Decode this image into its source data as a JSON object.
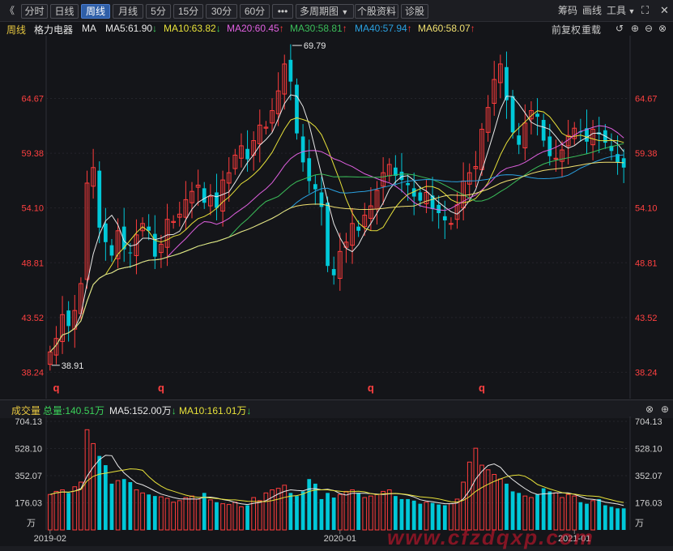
{
  "toolbar": {
    "back": "《",
    "tabs": [
      {
        "label": "分时",
        "active": false
      },
      {
        "label": "日线",
        "active": false
      },
      {
        "label": "周线",
        "active": true
      },
      {
        "label": "月线",
        "active": false
      },
      {
        "label": "5分",
        "active": false
      },
      {
        "label": "15分",
        "active": false
      },
      {
        "label": "30分",
        "active": false
      },
      {
        "label": "60分",
        "active": false
      }
    ],
    "more": "•••",
    "multi_period": "多周期图",
    "stock_info": "个股资料",
    "diagnose": "诊股",
    "right": {
      "chips": "筹码",
      "draw": "画线",
      "tools": "工具"
    }
  },
  "header": {
    "period": "周线",
    "stock_name": "格力电器",
    "ma_label": "MA",
    "ma": [
      {
        "label": "MA5:61.90",
        "dir": "↓",
        "color": "#e8e8e8"
      },
      {
        "label": "MA10:63.82",
        "dir": "↓",
        "color": "#e8e23a"
      },
      {
        "label": "MA20:60.45",
        "dir": "↑",
        "color": "#e060e0"
      },
      {
        "label": "MA30:58.81",
        "dir": "↑",
        "color": "#3bbf5a"
      },
      {
        "label": "MA40:57.94",
        "dir": "↑",
        "color": "#2aa0e0"
      },
      {
        "label": "MA60:58.07",
        "dir": "↑",
        "color": "#f0e070"
      }
    ],
    "adjust": "前复权",
    "reload": "重载"
  },
  "colors": {
    "up": "#ff3c3c",
    "down": "#00c8d8",
    "bg": "#141519"
  },
  "chart_data": {
    "type": "candlestick",
    "price_axis_ticks": [
      64.67,
      59.38,
      54.1,
      48.81,
      43.52,
      38.24
    ],
    "ylim": [
      36.0,
      70.5
    ],
    "annotations": [
      {
        "label": "69.79",
        "value": 69.79
      },
      {
        "label": "38.91",
        "value": 38.91
      }
    ],
    "event_markers": [
      "q",
      "q",
      "q",
      "q"
    ],
    "x_labels": [
      "2019-02",
      "2020-01",
      "2021-01"
    ],
    "closes": [
      40.2,
      41.5,
      43.8,
      42.7,
      44.2,
      46.8,
      56.5,
      58.0,
      52.2,
      50.8,
      49.5,
      51.9,
      50.1,
      49.8,
      51.5,
      52.6,
      51.9,
      49.4,
      50.6,
      53.0,
      52.8,
      53.5,
      54.9,
      55.7,
      56.3,
      54.6,
      55.2,
      54.1,
      56.8,
      57.5,
      59.2,
      60.1,
      58.8,
      60.6,
      62.1,
      61.9,
      63.5,
      65.4,
      68.0,
      66.3,
      61.3,
      58.5,
      56.7,
      55.9,
      54.2,
      48.5,
      47.6,
      49.9,
      50.8,
      52.6,
      51.9,
      53.4,
      54.3,
      55.8,
      57.5,
      58.3,
      57.2,
      56.8,
      56.3,
      55.2,
      54.8,
      55.6,
      54.0,
      53.6,
      52.9,
      52.6,
      54.4,
      56.7,
      57.5,
      58.1,
      61.7,
      63.8,
      66.5,
      68.0,
      64.5,
      61.4,
      60.2,
      62.3,
      63.5,
      62.9,
      60.6,
      59.1,
      58.9,
      59.7,
      61.1,
      61.8,
      61.4,
      60.5,
      61.7,
      61.2,
      60.4,
      59.6,
      58.5,
      58.0
    ],
    "volume": {
      "label": "成交量",
      "total_label": "总量:140.51万",
      "ma": [
        {
          "label": "MA5:152.00万",
          "dir": "↓",
          "color": "#e8e8e8"
        },
        {
          "label": "MA10:161.01万",
          "dir": "↓",
          "color": "#e8e23a"
        }
      ],
      "axis_ticks": [
        704.13,
        528.1,
        352.07,
        176.03
      ],
      "unit": "万",
      "ylim": [
        0,
        704.13
      ],
      "values": [
        230,
        250,
        260,
        240,
        280,
        310,
        650,
        560,
        480,
        420,
        300,
        320,
        330,
        310,
        260,
        240,
        230,
        220,
        215,
        205,
        180,
        190,
        210,
        220,
        200,
        240,
        195,
        180,
        170,
        165,
        180,
        150,
        160,
        210,
        190,
        240,
        260,
        270,
        290,
        240,
        220,
        250,
        330,
        300,
        200,
        240,
        210,
        230,
        250,
        260,
        240,
        210,
        220,
        230,
        250,
        260,
        220,
        200,
        200,
        190,
        170,
        180,
        175,
        165,
        160,
        170,
        200,
        310,
        440,
        530,
        420,
        390,
        360,
        330,
        300,
        250,
        240,
        220,
        210,
        230,
        270,
        250,
        240,
        210,
        230,
        220,
        180,
        170,
        190,
        200,
        160,
        150,
        140,
        140
      ]
    }
  },
  "watermark": "www.cfzdqxp.com"
}
